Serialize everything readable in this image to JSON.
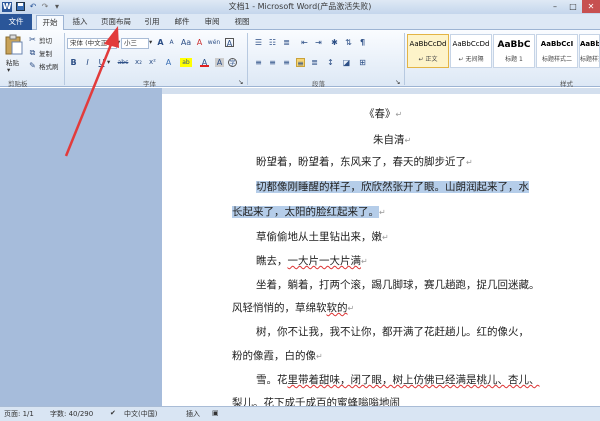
{
  "window": {
    "title": "文档1 - Microsoft Word(产品激活失败)",
    "min_icon": "minimize-icon",
    "max_icon": "maximize-icon",
    "close_icon": "close-icon"
  },
  "quick_access": {
    "word_icon": "W",
    "save_icon": "save-icon",
    "undo_icon": "undo-icon",
    "redo_icon": "redo-icon",
    "more": "▾"
  },
  "tabs": {
    "file": "文件",
    "home": "开始",
    "insert": "插入",
    "layout": "页面布局",
    "references": "引用",
    "mailings": "邮件",
    "review": "审阅",
    "view": "视图"
  },
  "ribbon": {
    "clipboard": {
      "paste": "粘贴",
      "cut": "剪切",
      "copy": "复制",
      "format_painter": "格式刷",
      "label": "剪贴板"
    },
    "font": {
      "font_name": "宋体 (中文正",
      "font_size": "小三",
      "grow": "A",
      "shrink": "A",
      "aa": "Aa",
      "clear": "A",
      "wen": "wén",
      "border_a": "A",
      "bold": "B",
      "italic": "I",
      "underline": "U",
      "strike": "abc",
      "sub": "x₂",
      "sup": "x²",
      "effects": "A",
      "highlight": "ab",
      "font_color": "A",
      "shade": "A",
      "circle": "字",
      "label": "字体"
    },
    "paragraph": {
      "label": "段落",
      "pilcrow": "¶"
    },
    "styles": {
      "label": "样式",
      "items": [
        {
          "sample": "AaBbCcDd",
          "name": "↵ 正文"
        },
        {
          "sample": "AaBbCcDd",
          "name": "↵ 无间隔"
        },
        {
          "sample": "AaBbC",
          "name": "标题 1"
        },
        {
          "sample": "AaBbCcI",
          "name": "标题样式二"
        },
        {
          "sample": "AaBbCcI",
          "name": "标题样式一"
        }
      ]
    }
  },
  "document": {
    "title": "《春》",
    "author": "朱自清",
    "para_mark": "↵",
    "lines": [
      {
        "pre": "盼望着，盼望着，东风来了，春天的脚步近了",
        "hl": "",
        "post": ""
      },
      {
        "pre": "",
        "hl": "切都像刚睡醒的样子，欣欣然张开了眼。山朗润起来了，水",
        "post": ""
      },
      {
        "pre": "",
        "hl": "长起来了，太阳的脸红起来了。",
        "post": ""
      },
      {
        "pre": "草偷偷地从土里钻出来，嫩",
        "hl": "",
        "post": ""
      },
      {
        "pre": "瞧去，",
        "hl": "",
        "post": "一大片一大片满"
      },
      {
        "pre": "坐着，躺着，打两个滚，踢几脚球，赛几趟跑，捉几回迷藏。",
        "hl": "",
        "post": ""
      },
      {
        "pre": "风轻悄悄的，草绵软",
        "hl": "",
        "post": "软的"
      },
      {
        "pre": "树，你不让我，我不让你，都开满了花赶趟儿。红的像火，",
        "hl": "",
        "post": ""
      },
      {
        "pre": "粉的像霞，白的像",
        "hl": "",
        "post": ""
      },
      {
        "pre": "雪。花",
        "hl": "",
        "post": "里带着甜味，闭了眼，树上仿佛已经满是桃儿、杏儿、"
      },
      {
        "pre": "梨儿。花下成千成百的蜜蜂嗡嗡地闹",
        "hl": "",
        "post": ""
      }
    ]
  },
  "status": {
    "page": "页面: 1/1",
    "words": "字数: 40/290",
    "lang": "中文(中国)",
    "mode": "插入"
  }
}
